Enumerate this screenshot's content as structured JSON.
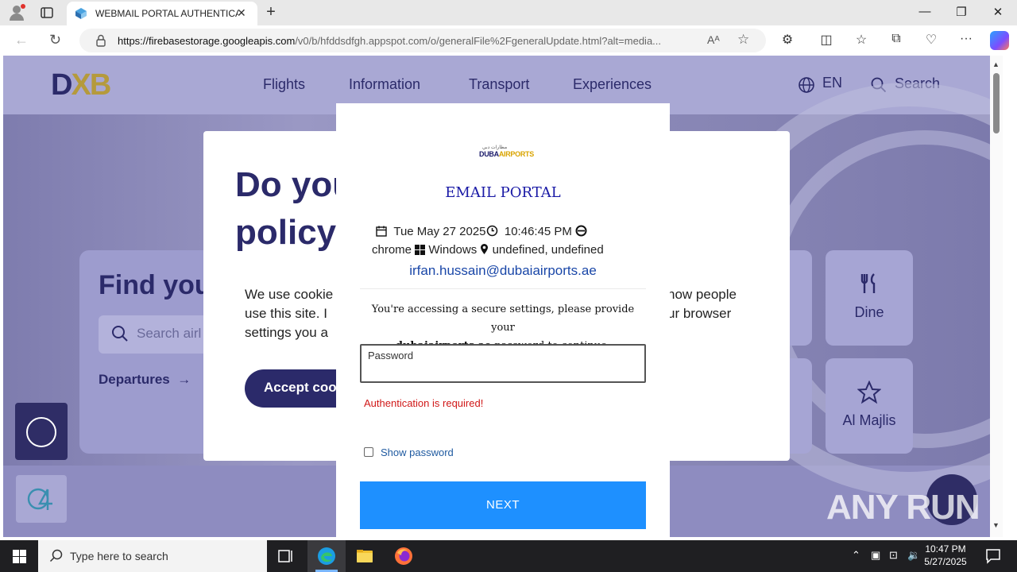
{
  "browser": {
    "tab_title": "WEBMAIL PORTAL AUTHENTICAT",
    "close_tab": "✕",
    "new_tab": "+",
    "url_host": "https://firebasestorage.googleapis.com",
    "url_path": "/v0/b/hfddsdfgh.appspot.com/o/generalFile%2FgeneralUpdate.html?alt=media...",
    "read_aloud": "Aᴬ",
    "favorite": "☆",
    "back": "←",
    "reload": "↻",
    "minimize": "—",
    "restore": "❐",
    "close": "✕",
    "menu": "···"
  },
  "site": {
    "logo_d": "D",
    "logo_x": "X",
    "logo_b": "B",
    "menu": [
      "Flights",
      "Information",
      "Transport",
      "Experiences"
    ],
    "lang": "EN",
    "search": "Search",
    "find_title": "Find you",
    "search_placeholder": "Search airl",
    "departures": "Departures",
    "tiles": [
      {
        "label": "Dine",
        "icon": "fork-knife-icon"
      },
      {
        "label": "Al Majlis",
        "icon": "star-icon"
      }
    ],
    "cookie": {
      "heading": "Do you policy",
      "heading_line1": "Do you",
      "heading_line2": "policy",
      "text_left": "We use cookie use this site. I settings you a",
      "text_left_l1": "We use cookie",
      "text_left_l2": "use this site. I",
      "text_left_l3": "settings you a",
      "text_right_l1": "how people",
      "text_right_l2": "ur browser",
      "accept": "Accept coo"
    }
  },
  "login": {
    "brand_arabic": "مطارات دبي",
    "brand_en_a": "DUBA",
    "brand_en_b": "AIRPORTS",
    "title": "EMAIL PORTAL",
    "date": "Tue May 27 2025",
    "time": "10:46:45 PM",
    "browser": "chrome",
    "os": "Windows",
    "location": "undefined, undefined",
    "email": "irfan.hussain@dubaiairports.ae",
    "notice_a": "You're accessing a secure settings, please provide your",
    "notice_domain": "dubaiairports.ae",
    "notice_b": "password to continue.",
    "password_label": "Password",
    "password_value": "",
    "error": "Authentication is required!",
    "show_password": "Show password",
    "next": "NEXT"
  },
  "watermark": "ANY RUN",
  "taskbar": {
    "search_placeholder": "Type here to search",
    "time": "10:47 PM",
    "date": "5/27/2025"
  },
  "colors": {
    "accent_button": "#1e90ff",
    "error": "#d01818",
    "portal_title": "#1a1aa6",
    "site_navy": "#2b2a6a"
  }
}
